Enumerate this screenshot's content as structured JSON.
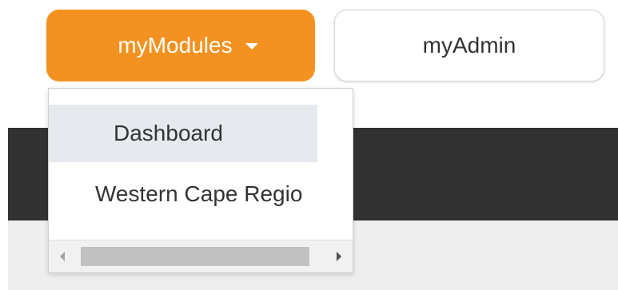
{
  "nav": {
    "modules_label": "myModules",
    "admin_label": "myAdmin"
  },
  "dropdown": {
    "items": [
      {
        "label": "Dashboard",
        "state": "hovered"
      },
      {
        "label": "Western Cape Regio"
      }
    ]
  },
  "colors": {
    "accent": "#f39220",
    "dark_band": "#323232",
    "light_band": "#eeeeee",
    "hover_bg": "#e6e9ee"
  },
  "icons": {
    "caret": "caret-down-icon",
    "scroll_left": "scroll-left-arrow-icon",
    "scroll_right": "scroll-right-arrow-icon"
  }
}
